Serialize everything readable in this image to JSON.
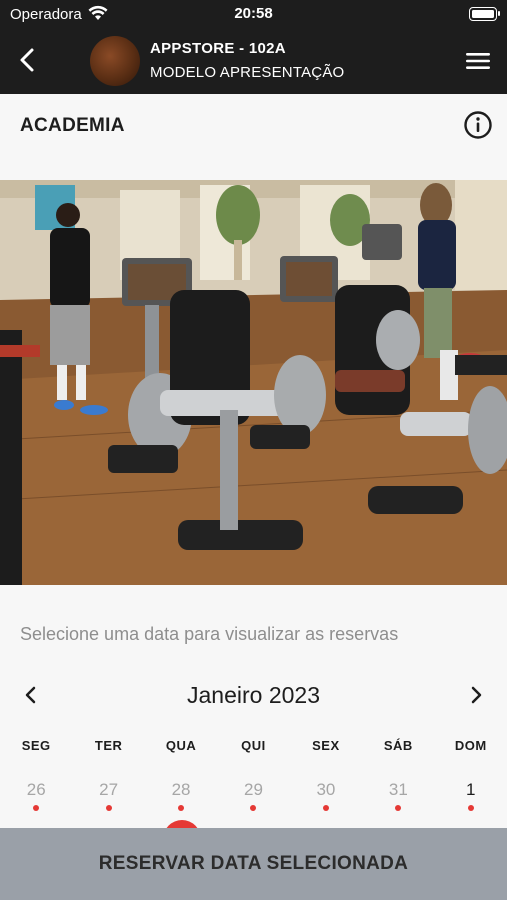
{
  "status_bar": {
    "carrier": "Operadora",
    "time": "20:58"
  },
  "navbar": {
    "title": "APPSTORE - 102A",
    "subtitle": "MODELO APRESENTAÇÃO"
  },
  "section": {
    "title": "ACADEMIA"
  },
  "calendar": {
    "prompt": "Selecione uma data para visualizar as reservas",
    "month": "Janeiro 2023",
    "weekdays": [
      "SEG",
      "TER",
      "QUA",
      "QUI",
      "SEX",
      "SÁB",
      "DOM"
    ],
    "days": [
      {
        "label": "26",
        "current_month": false,
        "has_reservation": true
      },
      {
        "label": "27",
        "current_month": false,
        "has_reservation": true
      },
      {
        "label": "28",
        "current_month": false,
        "has_reservation": true
      },
      {
        "label": "29",
        "current_month": false,
        "has_reservation": true
      },
      {
        "label": "30",
        "current_month": false,
        "has_reservation": true
      },
      {
        "label": "31",
        "current_month": false,
        "has_reservation": true
      },
      {
        "label": "1",
        "current_month": true,
        "has_reservation": true
      }
    ]
  },
  "reserve_button": {
    "label": "RESERVAR DATA SELECIONADA"
  },
  "colors": {
    "header_bg": "#1d1d1d",
    "accent_dot": "#e53935",
    "button_bg": "#9aa0a8"
  },
  "icons": [
    "wifi-icon",
    "battery-icon",
    "back-arrow-icon",
    "hamburger-menu-icon",
    "info-icon",
    "chevron-left-icon",
    "chevron-right-icon"
  ]
}
